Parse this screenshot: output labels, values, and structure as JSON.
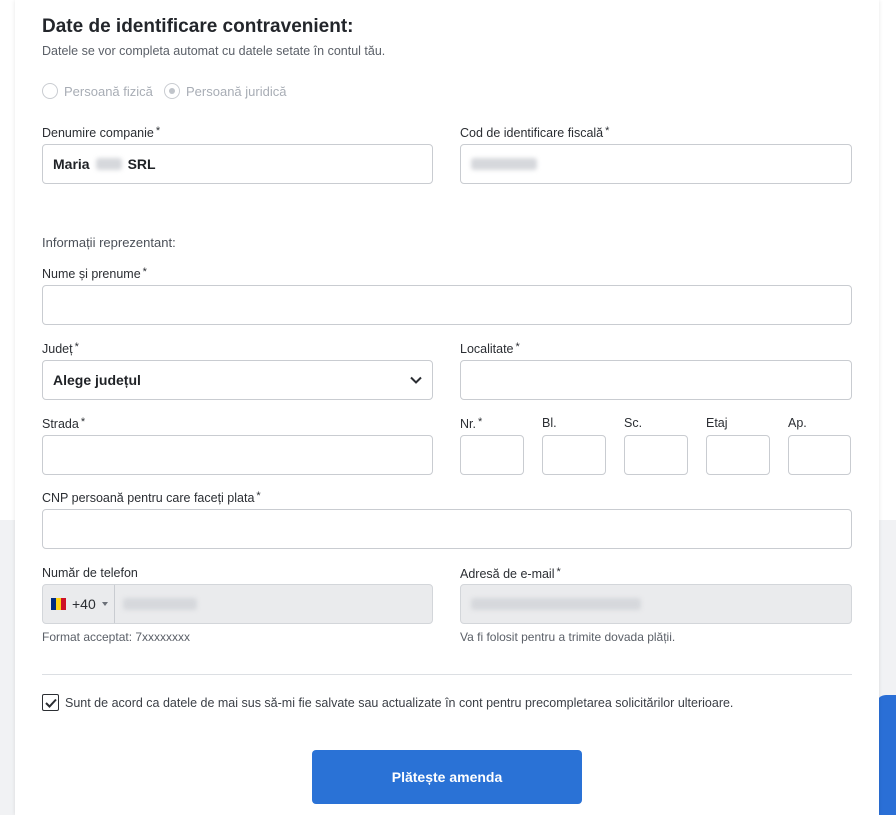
{
  "section": {
    "title": "Date de identificare contravenient:",
    "subtitle": "Datele se vor completa automat cu datele setate în contul tău."
  },
  "person_type": {
    "options": [
      "Persoană fizică",
      "Persoană juridică"
    ],
    "selected": "Persoană juridică"
  },
  "company": {
    "name_label": "Denumire companie",
    "name_value_prefix": "Maria",
    "name_value_suffix": "SRL",
    "fiscal_label": "Cod de identificare fiscală"
  },
  "representative": {
    "heading": "Informații reprezentant:",
    "full_name_label": "Nume și prenume",
    "county_label": "Județ",
    "county_selected": "Alege județul",
    "locality_label": "Localitate",
    "street_label": "Strada",
    "nr_label": "Nr.",
    "bl_label": "Bl.",
    "sc_label": "Sc.",
    "floor_label": "Etaj",
    "ap_label": "Ap.",
    "cnp_label": "CNP persoană pentru care faceți plata",
    "required_mark": "*"
  },
  "contact": {
    "phone_label": "Număr de telefon",
    "phone_prefix": "+40",
    "phone_hint": "Format acceptat: 7xxxxxxxx",
    "email_label": "Adresă de e-mail",
    "email_hint": "Va fi folosit pentru a trimite dovada plății."
  },
  "consent": {
    "checked": true,
    "text": "Sunt de acord ca datele de mai sus să-mi fie salvate sau actualizate în cont pentru precompletarea solicitărilor ulterioare."
  },
  "actions": {
    "pay_label": "Plătește amenda"
  },
  "colors": {
    "accent": "#2a72d6",
    "disabled_field": "#eaebed",
    "flag_blue": "#002b7f",
    "flag_yellow": "#fcd116",
    "flag_red": "#ce1126"
  },
  "icons": [
    "chevron-down-icon",
    "caret-down-icon",
    "check-icon",
    "romania-flag-icon"
  ]
}
